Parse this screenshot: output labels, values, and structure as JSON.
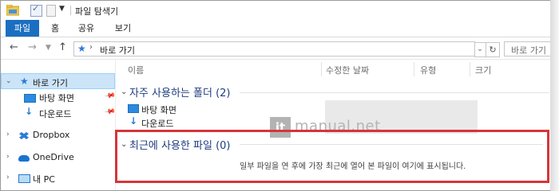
{
  "window": {
    "title": "파일 탐색기"
  },
  "ribbon": {
    "tabs": [
      {
        "label": "파일",
        "active": true
      },
      {
        "label": "홈",
        "active": false
      },
      {
        "label": "공유",
        "active": false
      },
      {
        "label": "보기",
        "active": false
      }
    ],
    "accent_color": "#1a6fc1"
  },
  "address_bar": {
    "path": "바로 가기",
    "search_placeholder": "바로 가기"
  },
  "sidebar": {
    "items": [
      {
        "label": "바로 가기",
        "icon": "star-icon",
        "selected": true
      },
      {
        "label": "바탕 화면",
        "icon": "desktop-icon",
        "pinned": true
      },
      {
        "label": "다운로드",
        "icon": "download-icon",
        "pinned": true
      },
      {
        "label": "Dropbox",
        "icon": "dropbox-icon"
      },
      {
        "label": "OneDrive",
        "icon": "cloud-icon"
      },
      {
        "label": "내 PC",
        "icon": "pc-icon"
      }
    ]
  },
  "content": {
    "columns": [
      "이름",
      "수정한 날짜",
      "유형",
      "크기"
    ],
    "groups": [
      {
        "title": "자주 사용하는 폴더 (2)",
        "items": [
          {
            "label": "바탕 화면",
            "icon": "desktop-icon"
          },
          {
            "label": "다운로드",
            "icon": "download-icon"
          }
        ]
      },
      {
        "title": "최근에 사용한 파일 (0)",
        "empty_message": "일부 파일을 연 후에 가장 최근에 열어 본 파일이 여기에 표시됩니다."
      }
    ]
  },
  "watermark": {
    "logo": "it",
    "text": "manual.net"
  },
  "highlight_color": "#d4363a"
}
